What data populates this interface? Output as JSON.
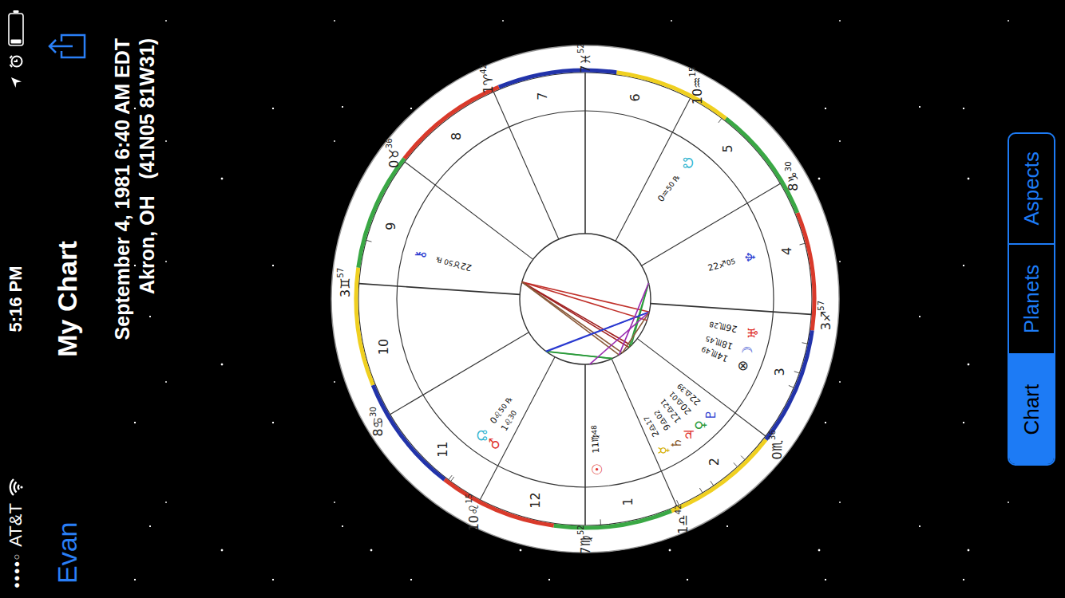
{
  "status_bar": {
    "signal": "●●●●○",
    "carrier": "AT&T",
    "time": "5:16 PM"
  },
  "nav": {
    "back": "Evan",
    "title": "My Chart"
  },
  "header": {
    "date": "September 4, 1981 6:40 AM EDT",
    "place": "Akron, OH   (41N05 81W31)"
  },
  "chart": {
    "zodiac": [
      {
        "glyph": "♈",
        "color": "#d93a2b"
      },
      {
        "glyph": "♉",
        "color": "#3aa845"
      },
      {
        "glyph": "♊",
        "color": "#f0d020"
      },
      {
        "glyph": "♋",
        "color": "#2233aa"
      },
      {
        "glyph": "♌",
        "color": "#d93a2b"
      },
      {
        "glyph": "♍",
        "color": "#3aa845"
      },
      {
        "glyph": "♎",
        "color": "#f0d020"
      },
      {
        "glyph": "♏",
        "color": "#2233aa"
      },
      {
        "glyph": "♐",
        "color": "#d93a2b"
      },
      {
        "glyph": "♑",
        "color": "#3aa845"
      },
      {
        "glyph": "♒",
        "color": "#f0d020"
      },
      {
        "glyph": "♓",
        "color": "#2233aa"
      }
    ],
    "cusps": [
      {
        "house": "1",
        "deg": "7",
        "sign": "♍",
        "min": "52"
      },
      {
        "house": "2",
        "deg": "1",
        "sign": "♎",
        "min": "42"
      },
      {
        "house": "3",
        "deg": "0",
        "sign": "♏",
        "min": "36"
      },
      {
        "house": "4",
        "deg": "3",
        "sign": "♐",
        "min": "57"
      },
      {
        "house": "5",
        "deg": "8",
        "sign": "♑",
        "min": "30"
      },
      {
        "house": "6",
        "deg": "10",
        "sign": "♒",
        "min": "15"
      },
      {
        "house": "7",
        "deg": "7",
        "sign": "♓",
        "min": "52"
      },
      {
        "house": "8",
        "deg": "1",
        "sign": "♈",
        "min": "42"
      },
      {
        "house": "9",
        "deg": "0",
        "sign": "♉",
        "min": "36"
      },
      {
        "house": "10",
        "deg": "3",
        "sign": "♊",
        "min": "57"
      },
      {
        "house": "11",
        "deg": "8",
        "sign": "♋",
        "min": "30"
      },
      {
        "house": "12",
        "deg": "10",
        "sign": "♌",
        "min": "15"
      }
    ],
    "retrograde_mark": "℞",
    "planets": [
      {
        "glyph": "☉",
        "deg": "11",
        "sign": "♍",
        "min": "48",
        "retrograde": false,
        "color": "#e0302a"
      },
      {
        "glyph": "☽",
        "deg": "18",
        "sign": "♏",
        "min": "45",
        "retrograde": false,
        "color": "#3a4fd0"
      },
      {
        "glyph": "☿",
        "deg": "2",
        "sign": "♎",
        "min": "17",
        "retrograde": false,
        "color": "#d4b000"
      },
      {
        "glyph": "♀",
        "deg": "20",
        "sign": "♎",
        "min": "01",
        "retrograde": false,
        "color": "#2a9a3a"
      },
      {
        "glyph": "♂",
        "deg": "1",
        "sign": "♌",
        "min": "30",
        "retrograde": false,
        "color": "#e0302a"
      },
      {
        "glyph": "♃",
        "deg": "12",
        "sign": "♎",
        "min": "21",
        "retrograde": false,
        "color": "#e0302a"
      },
      {
        "glyph": "♄",
        "deg": "9",
        "sign": "♎",
        "min": "02",
        "retrograde": false,
        "color": "#8a5a2a"
      },
      {
        "glyph": "♅",
        "deg": "26",
        "sign": "♏",
        "min": "28",
        "retrograde": false,
        "color": "#e0302a"
      },
      {
        "glyph": "♆",
        "deg": "22",
        "sign": "♐",
        "min": "05",
        "retrograde": false,
        "color": "#2a3ad0"
      },
      {
        "glyph": "♇",
        "deg": "22",
        "sign": "♎",
        "min": "39",
        "retrograde": false,
        "color": "#2a3ad0"
      },
      {
        "glyph": "☊",
        "deg": "0",
        "sign": "♌",
        "min": "50",
        "retrograde": true,
        "color": "#30b4d0"
      },
      {
        "glyph": "☋",
        "deg": "0",
        "sign": "♒",
        "min": "50",
        "retrograde": true,
        "color": "#30b4d0"
      },
      {
        "glyph": "⚷",
        "deg": "22",
        "sign": "♉",
        "min": "50",
        "retrograde": true,
        "color": "#2a3ad0"
      },
      {
        "glyph": "⊗",
        "deg": "14",
        "sign": "♏",
        "min": "49",
        "retrograde": false,
        "color": "#222222"
      }
    ],
    "aspects": [
      {
        "a": 12,
        "b": 1,
        "color": "#c0302a"
      },
      {
        "a": 12,
        "b": 7,
        "color": "#c0302a"
      },
      {
        "a": 12,
        "b": 9,
        "color": "#a02020"
      },
      {
        "a": 12,
        "b": 3,
        "color": "#a02020"
      },
      {
        "a": 12,
        "b": 6,
        "color": "#8a5a3a"
      },
      {
        "a": 12,
        "b": 5,
        "color": "#8a5a3a"
      },
      {
        "a": 2,
        "b": 4,
        "color": "#2a9a3a"
      },
      {
        "a": 2,
        "b": 10,
        "color": "#2a9a3a"
      },
      {
        "a": 3,
        "b": 8,
        "color": "#2a9a3a"
      },
      {
        "a": 9,
        "b": 8,
        "color": "#2a9a3a"
      },
      {
        "a": 4,
        "b": 7,
        "color": "#2a3ad0"
      },
      {
        "a": 10,
        "b": 7,
        "color": "#2a3ad0"
      },
      {
        "a": 0,
        "b": 7,
        "color": "#9a2ab0"
      },
      {
        "a": 6,
        "b": 8,
        "color": "#9a2ab0"
      },
      {
        "a": 5,
        "b": 7,
        "color": "#8a5a3a"
      }
    ]
  },
  "tabs": [
    {
      "label": "Chart",
      "selected": true
    },
    {
      "label": "Planets",
      "selected": false
    },
    {
      "label": "Aspects",
      "selected": false
    }
  ]
}
